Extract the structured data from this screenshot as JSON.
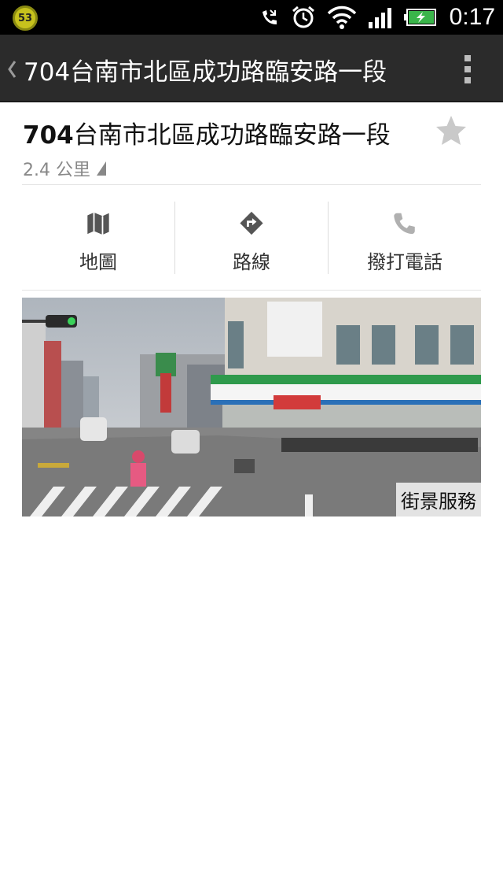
{
  "status_bar": {
    "notification_count": "53",
    "time": "0:17"
  },
  "action_bar": {
    "title": "704台南市北區成功路臨安路一段"
  },
  "place": {
    "title_number": "704",
    "title_text": "台南市北區成功路臨安路一段",
    "distance": "2.4 公里"
  },
  "actions": [
    {
      "label": "地圖",
      "icon": "map-icon"
    },
    {
      "label": "路線",
      "icon": "directions-icon"
    },
    {
      "label": "撥打電話",
      "icon": "phone-icon"
    }
  ],
  "street_view": {
    "label": "街景服務"
  },
  "colors": {
    "status_bar": "#000000",
    "action_bar": "#2b2b2b",
    "icon_gray": "#555555"
  }
}
